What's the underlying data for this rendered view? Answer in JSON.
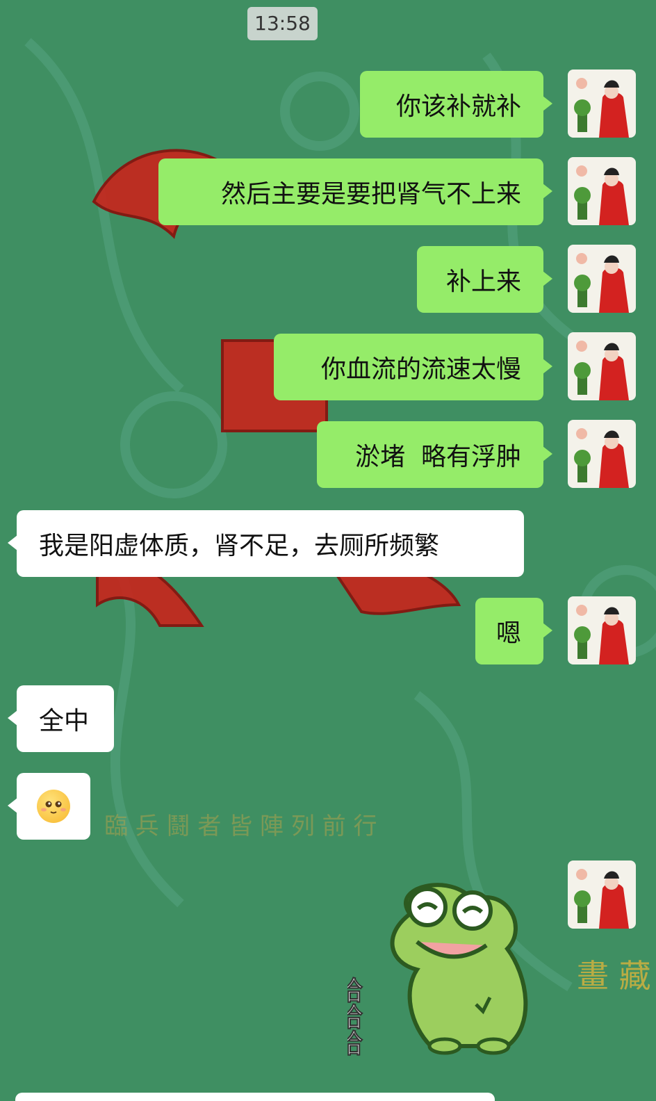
{
  "chat": {
    "timestamp": "13:58",
    "messages": [
      {
        "side": "sent",
        "text": "你该补就补"
      },
      {
        "side": "sent",
        "text": "然后主要是要把肾气不上来"
      },
      {
        "side": "sent",
        "text": "补上来"
      },
      {
        "side": "sent",
        "text": "你血流的流速太慢"
      },
      {
        "side": "sent",
        "text": "淤堵  略有浮肿"
      },
      {
        "side": "recv",
        "text": "我是阳虚体质，肾不足，去厕所频繁"
      },
      {
        "side": "sent",
        "text": "嗯"
      },
      {
        "side": "recv",
        "text": "全中"
      },
      {
        "side": "recv",
        "text": "",
        "emoji": "pleading-face"
      },
      {
        "side": "sent",
        "text": "",
        "sticker": "frog-laughing"
      }
    ]
  },
  "sticker": {
    "caption": "哈哈哈"
  },
  "background": {
    "watermark_line": "臨 兵 鬪 者 皆 陣 列 前 行",
    "side_text": "畫 藏"
  },
  "colors": {
    "sent_bubble": "#95ec69",
    "recv_bubble": "#ffffff",
    "background": "#3f8f62"
  }
}
